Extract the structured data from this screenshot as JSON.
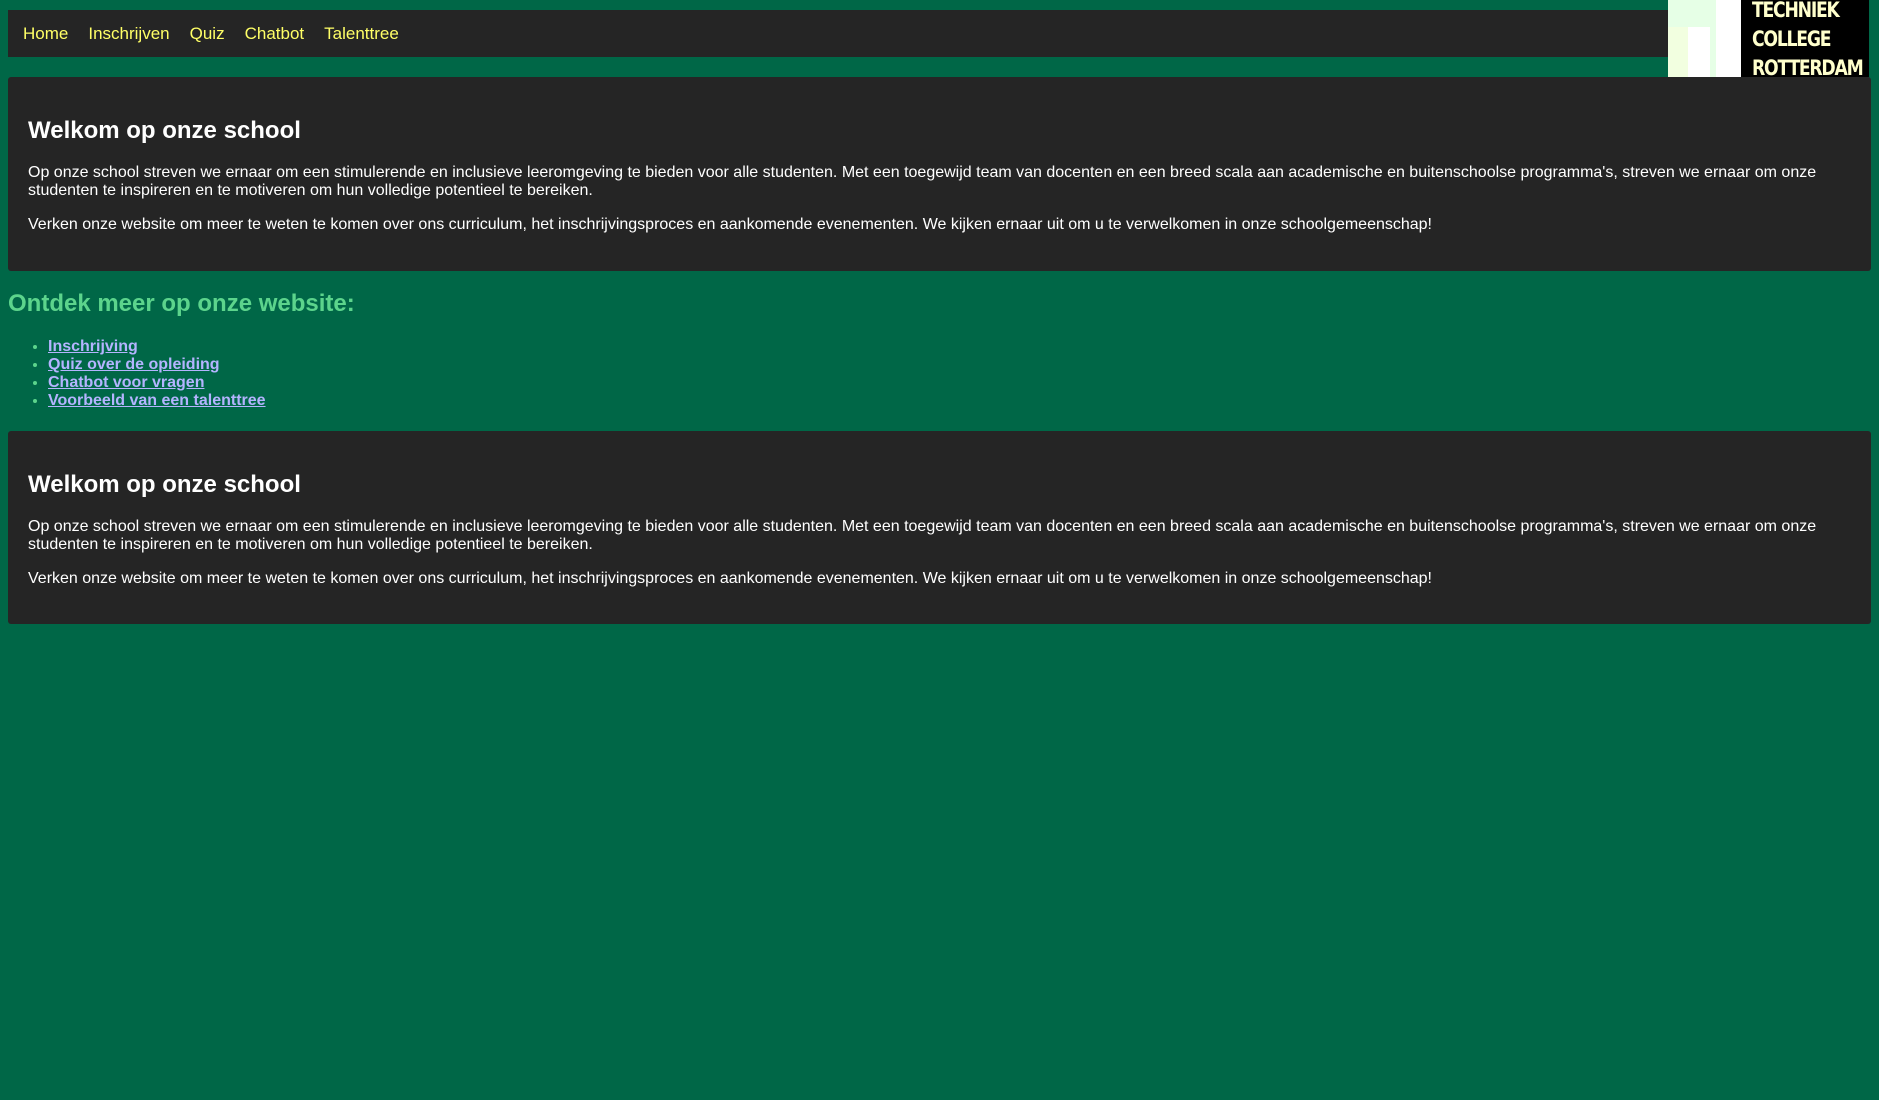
{
  "nav": {
    "items": [
      {
        "label": "Home"
      },
      {
        "label": "Inschrijven"
      },
      {
        "label": "Quiz"
      },
      {
        "label": "Chatbot"
      },
      {
        "label": "Talenttree"
      }
    ]
  },
  "logo": {
    "line1": "TECHNIEK",
    "line2": "COLLEGE",
    "line3": "ROTTERDAM"
  },
  "welcome_1": {
    "title": "Welkom op onze school",
    "paragraph1": "Op onze school streven we ernaar om een stimulerende en inclusieve leeromgeving te bieden voor alle studenten. Met een toegewijd team van docenten en een breed scala aan academische en buitenschoolse programma's, streven we ernaar om onze studenten te inspireren en te motiveren om hun volledige potentieel te bereiken.",
    "paragraph2": "Verken onze website om meer te weten te komen over ons curriculum, het inschrijvingsproces en aankomende evenementen. We kijken ernaar uit om u te verwelkomen in onze schoolgemeenschap!"
  },
  "discover": {
    "title": "Ontdek meer op onze website:",
    "links": [
      {
        "label": "Inschrijving"
      },
      {
        "label": "Quiz over de opleiding"
      },
      {
        "label": "Chatbot voor vragen"
      },
      {
        "label": "Voorbeeld van een talenttree"
      }
    ]
  },
  "welcome_2": {
    "title": "Welkom op onze school",
    "paragraph1": "Op onze school streven we ernaar om een stimulerende en inclusieve leeromgeving te bieden voor alle studenten. Met een toegewijd team van docenten en een breed scala aan academische en buitenschoolse programma's, streven we ernaar om onze studenten te inspireren en te motiveren om hun volledige potentieel te bereiken.",
    "paragraph2": "Verken onze website om meer te weten te komen over ons curriculum, het inschrijvingsproces en aankomende evenementen. We kijken ernaar uit om u te verwelkomen in onze schoolgemeenschap!"
  },
  "colors": {
    "page_background": "#006747",
    "panel_background": "#252525",
    "nav_link": "#ffff66",
    "heading_green": "#5cd48c",
    "list_link": "#b4b4ff",
    "logo_text": "#ffffcc"
  }
}
